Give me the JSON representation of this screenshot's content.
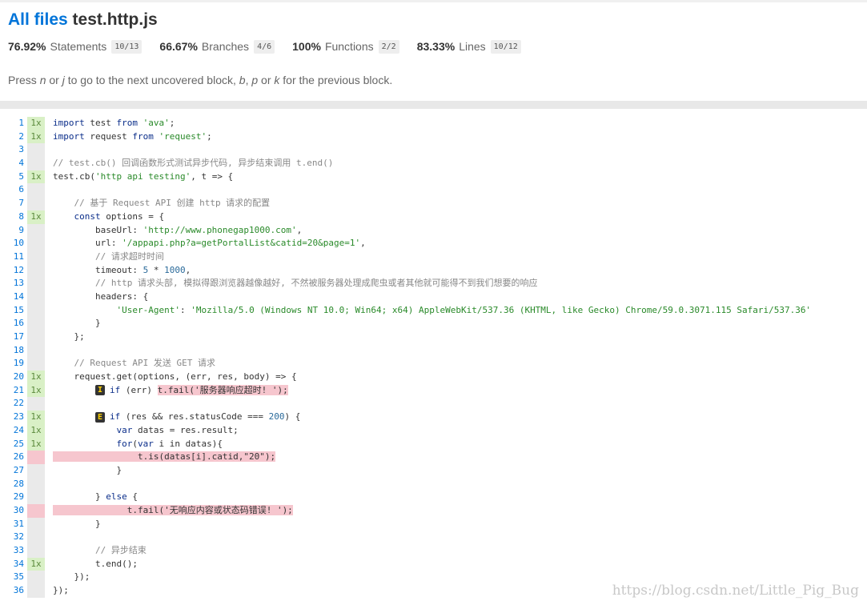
{
  "header": {
    "all_files": "All files",
    "filename": "test.http.js"
  },
  "stats": [
    {
      "pct": "76.92%",
      "label": "Statements",
      "frac": "10/13"
    },
    {
      "pct": "66.67%",
      "label": "Branches",
      "frac": "4/6"
    },
    {
      "pct": "100%",
      "label": "Functions",
      "frac": "2/2"
    },
    {
      "pct": "83.33%",
      "label": "Lines",
      "frac": "10/12"
    }
  ],
  "hint": {
    "t1": "Press ",
    "n": "n",
    "t2": " or ",
    "j": "j",
    "t3": " to go to the next uncovered block, ",
    "b": "b",
    "t4": ", ",
    "p": "p",
    "t5": " or ",
    "k": "k",
    "t6": " for the previous block."
  },
  "code": {
    "ln": [
      "1",
      "2",
      "3",
      "4",
      "5",
      "6",
      "7",
      "8",
      "9",
      "10",
      "11",
      "12",
      "13",
      "14",
      "15",
      "16",
      "17",
      "18",
      "19",
      "20",
      "21",
      "22",
      "23",
      "24",
      "25",
      "26",
      "27",
      "28",
      "29",
      "30",
      "31",
      "32",
      "33",
      "34",
      "35",
      "36"
    ],
    "hits": {
      "1": "1x",
      "2": "1x",
      "5": "1x",
      "8": "1x",
      "20": "1x",
      "21": "1x",
      "23": "1x",
      "24": "1x",
      "25": "1x",
      "34": "1x"
    },
    "l1_kw": "import",
    "l1_a": " test ",
    "l1_from": "from",
    "l1_s": "'ava'",
    "l1_e": ";",
    "l2_kw": "import",
    "l2_a": " request ",
    "l2_from": "from",
    "l2_s": "'request'",
    "l2_e": ";",
    "l4": "// test.cb() 回调函数形式测试异步代码, 异步结束调用 t.end()",
    "l5_a": "test.cb(",
    "l5_s": "'http api testing'",
    "l5_b": ", t => {",
    "l7": "    // 基于 Request API 创建 http 请求的配置",
    "l8_kw": "    const",
    "l8_a": " options = {",
    "l9_a": "        baseUrl: ",
    "l9_s": "'http://www.phonegap1000.com'",
    "l9_b": ",",
    "l10_a": "        url: ",
    "l10_s": "'/appapi.php?a=getPortalList&catid=20&page=1'",
    "l10_b": ",",
    "l11": "        // 请求超时时间",
    "l12_a": "        timeout: ",
    "l12_n": "5",
    "l12_b": " * ",
    "l12_n2": "1000",
    "l12_c": ",",
    "l13": "        // http 请求头部, 模拟得跟浏览器越像越好, 不然被服务器处理成爬虫或者其他就可能得不到我们想要的响应",
    "l14": "        headers: {",
    "l15_a": "            ",
    "l15_s": "'User-Agent'",
    "l15_b": ": ",
    "l15_s2": "'Mozilla/5.0 (Windows NT 10.0; Win64; x64) AppleWebKit/537.36 (KHTML, like Gecko) Chrome/59.0.3071.115 Safari/537.36'",
    "l16": "        }",
    "l17": "    };",
    "l19": "    // Request API 发送 GET 请求",
    "l20": "    request.get(options, (err, res, body) => {",
    "l21_badge": "I",
    "l21_kw": "if",
    "l21_a": " (err) ",
    "l21_hl": "t.fail('服务器响应超时! ');",
    "l23_badge": "E",
    "l23_kw": "if",
    "l23_a": " (res && res.statusCode === ",
    "l23_n": "200",
    "l23_b": ") {",
    "l24_kw": "            var",
    "l24_a": " datas = res.result;",
    "l25_kw": "            for",
    "l25_a": "(",
    "l25_kw2": "var",
    "l25_b": " i in datas){",
    "l26": "                t.is(datas[i].catid,\"20\");",
    "l27": "            }",
    "l29_a": "        } ",
    "l29_kw": "else",
    "l29_b": " {",
    "l30": "              t.fail('无响应内容或状态码错误! ');",
    "l31": "        }",
    "l33": "        // 异步结束",
    "l34": "        t.end();",
    "l35": "    });",
    "l36": "});"
  },
  "watermark": "https://blog.csdn.net/Little_Pig_Bug"
}
